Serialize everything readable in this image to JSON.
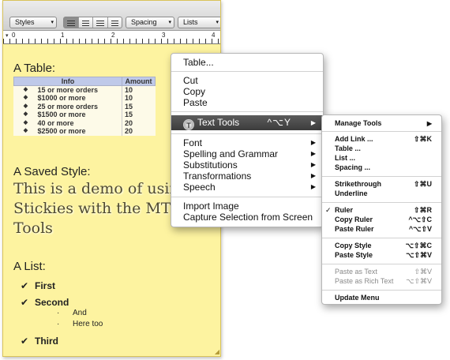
{
  "toolbar": {
    "styles_label": "Styles",
    "spacing_label": "Spacing",
    "lists_label": "Lists",
    "popup_arrow_icon": "updown-arrows-icon",
    "align_buttons": [
      "align-left-icon",
      "align-center-icon",
      "align-right-icon",
      "align-justify-icon"
    ]
  },
  "ruler": {
    "numbers": [
      "0",
      "1",
      "2",
      "3",
      "4"
    ]
  },
  "note": {
    "table_heading": "A Table:",
    "table": {
      "headers": [
        "Info",
        "Amount"
      ],
      "rows": [
        {
          "bullet": "◆",
          "info": "15 or more orders",
          "amount": "10"
        },
        {
          "bullet": "◆",
          "info": "$1000 or more",
          "amount": "10"
        },
        {
          "bullet": "◆",
          "info": "25 or more orders",
          "amount": "15"
        },
        {
          "bullet": "◆",
          "info": "$1500 or more",
          "amount": "15"
        },
        {
          "bullet": "◆",
          "info": "40 or more",
          "amount": "20"
        },
        {
          "bullet": "◆",
          "info": "$2500 or more",
          "amount": "20"
        }
      ]
    },
    "saved_style_heading": "A Saved Style:",
    "saved_style_lines": [
      "This is a demo of using",
      "Stickies with the MT Tex",
      "Tools"
    ],
    "list_heading": "A List:",
    "list": {
      "check": "✔",
      "items": [
        "First",
        "Second",
        "Third"
      ],
      "sub_bullet": "·",
      "sub_items": [
        "And",
        "Here too"
      ]
    }
  },
  "context_menu": {
    "table": "Table...",
    "cut": "Cut",
    "copy": "Copy",
    "paste": "Paste",
    "text_tools": "Text Tools",
    "text_tools_shortcut": "^⌥Y",
    "font": "Font",
    "spelling": "Spelling and Grammar",
    "substitutions": "Substitutions",
    "transformations": "Transformations",
    "speech": "Speech",
    "import_image": "Import Image",
    "capture": "Capture Selection from Screen"
  },
  "submenu": {
    "manage_tools": "Manage Tools",
    "add_link": "Add Link ...",
    "add_link_key": "⇧⌘K",
    "table": "Table ...",
    "list": "List ...",
    "spacing": "Spacing ...",
    "strikethrough": "Strikethrough",
    "strikethrough_key": "⇧⌘U",
    "underline": "Underline",
    "ruler": "Ruler",
    "ruler_key": "⇧⌘R",
    "ruler_checked": "✓",
    "copy_ruler": "Copy Ruler",
    "copy_ruler_key": "^⌥⇧C",
    "paste_ruler": "Paste Ruler",
    "paste_ruler_key": "^⌥⇧V",
    "copy_style": "Copy Style",
    "copy_style_key": "⌥⇧⌘C",
    "paste_style": "Paste Style",
    "paste_style_key": "⌥⇧⌘V",
    "paste_as_text": "Paste as Text",
    "paste_as_text_key": "⇧⌘V",
    "paste_as_rich": "Paste as Rich Text",
    "paste_as_rich_key": "⌥⇧⌘V",
    "update_menu": "Update Menu"
  }
}
